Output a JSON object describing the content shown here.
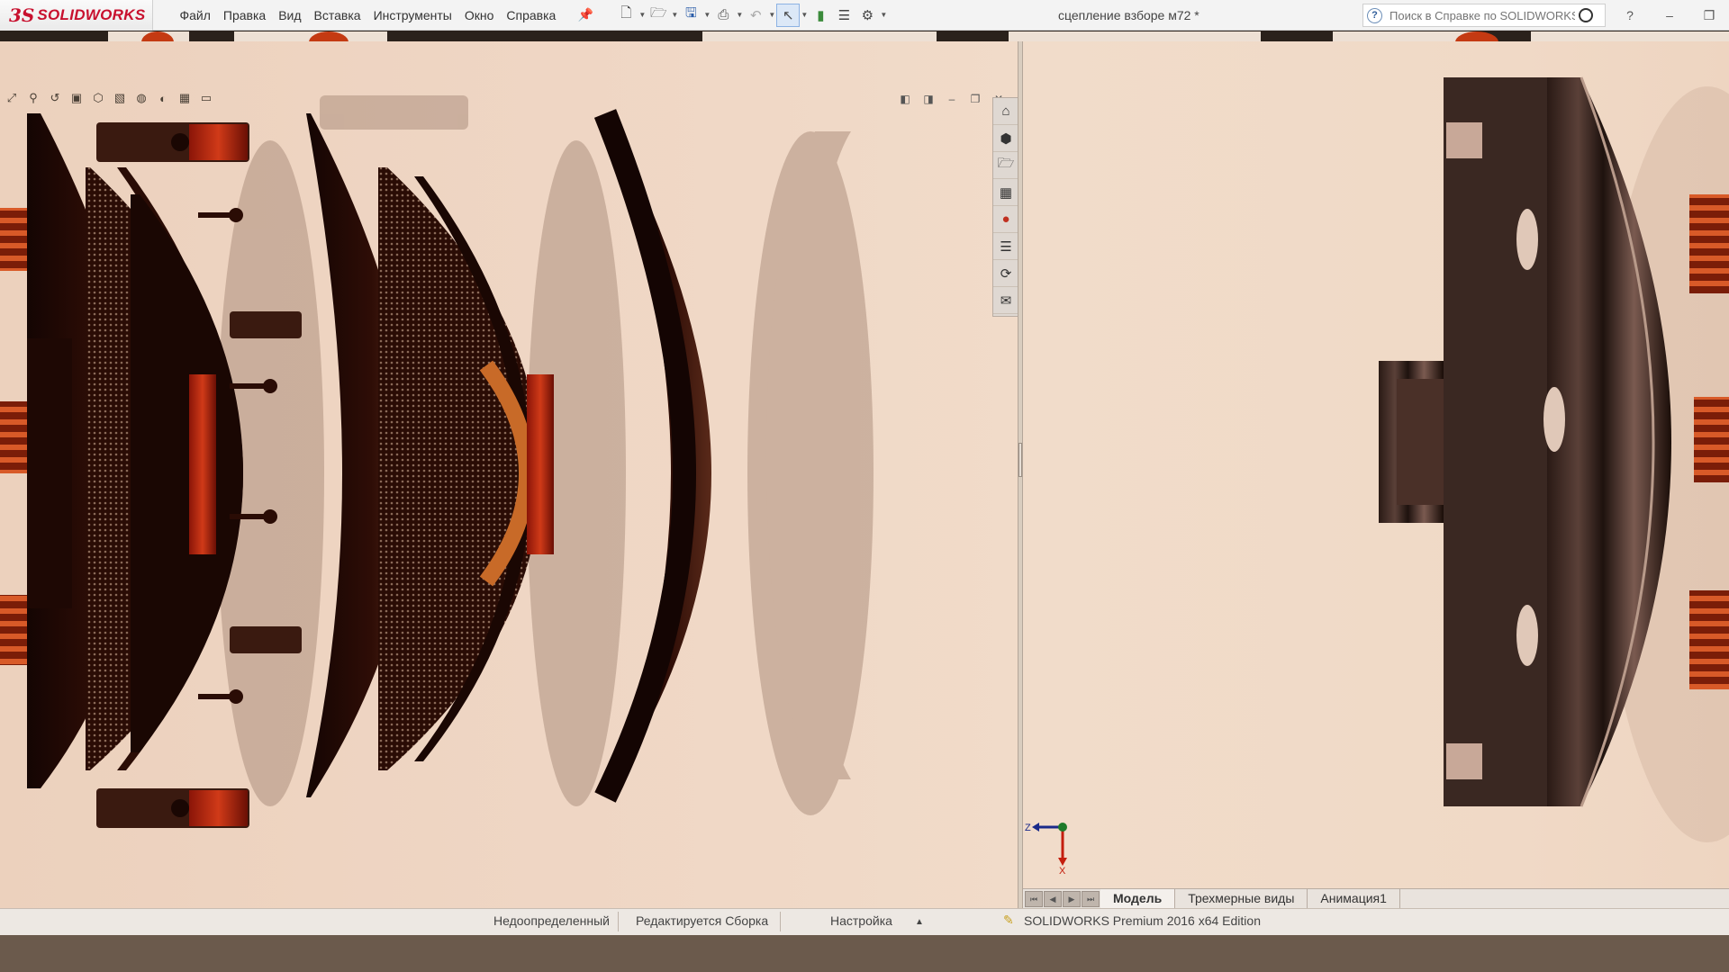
{
  "app": {
    "logo_prefix": "3S",
    "logo_text": "SOLIDWORKS",
    "menu": [
      "Файл",
      "Правка",
      "Вид",
      "Вставка",
      "Инструменты",
      "Окно",
      "Справка"
    ],
    "document_title": "сцепление взборе м72 *",
    "search_placeholder": "Поиск в Справке по SOLIDWORKS",
    "help_icon_label": "?"
  },
  "toolbar_icons": [
    "new-document-icon",
    "open-icon",
    "save-icon",
    "print-icon",
    "undo-icon",
    "select-icon",
    "rebuild-icon",
    "file-properties-icon",
    "options-icon"
  ],
  "task_pane_icons": [
    "home-icon",
    "parts-icon",
    "folder-icon",
    "view-palette-icon",
    "appearance-icon",
    "custom-properties-icon",
    "solidworks-resources-icon",
    "forum-icon"
  ],
  "model_tabs": {
    "items": [
      "Модель",
      "Трехмерные виды",
      "Анимация1"
    ],
    "active": "Модель"
  },
  "status": {
    "edition": "SOLIDWORKS Premium 2016 x64 Edition",
    "definition": "Недоопределенный",
    "editing": "Редактируется Сборка",
    "settings": "Настройка"
  },
  "triad": {
    "axis_z": "Z",
    "axis_x": "X"
  },
  "colors": {
    "brand": "#c8102e",
    "viewport_bg": "#efd6c4",
    "part_dark": "#2a0c05",
    "spring": "#c43a12"
  }
}
